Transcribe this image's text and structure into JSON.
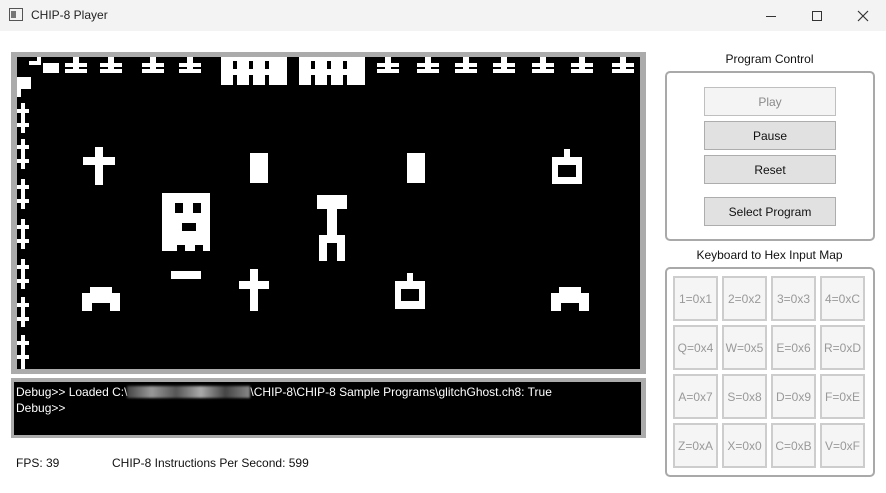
{
  "window": {
    "title": "CHIP-8 Player"
  },
  "console": {
    "line1_prefix": "Debug>> Loaded C:\\",
    "line1_suffix": "\\CHIP-8\\CHIP-8 Sample Programs\\glitchGhost.ch8: True",
    "line2": "Debug>>"
  },
  "status": {
    "fps": "FPS: 39",
    "ips": "CHIP-8 Instructions Per Second: 599"
  },
  "program_control": {
    "title": "Program Control",
    "play_label": "Play",
    "pause_label": "Pause",
    "reset_label": "Reset",
    "select_label": "Select Program"
  },
  "keymap": {
    "title": "Keyboard to Hex Input Map",
    "keys": [
      "1=0x1",
      "2=0x2",
      "3=0x3",
      "4=0xC",
      "Q=0x4",
      "W=0x5",
      "E=0x6",
      "R=0xD",
      "A=0x7",
      "S=0x8",
      "D=0x9",
      "F=0xE",
      "Z=0xA",
      "X=0x0",
      "C=0xB",
      "V=0xF"
    ]
  }
}
